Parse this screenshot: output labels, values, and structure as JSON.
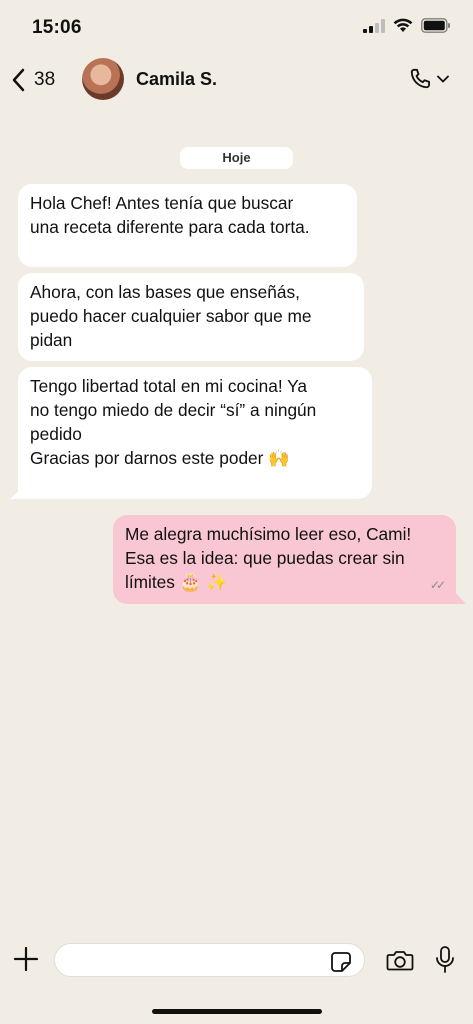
{
  "status_bar": {
    "time": "15:06",
    "icons": [
      "signal-icon",
      "wifi-icon",
      "battery-icon"
    ]
  },
  "header": {
    "back_count": "38",
    "contact_name": "Camila S.",
    "icons": [
      "back-chevron-icon",
      "avatar",
      "phone-icon",
      "chevron-down-icon"
    ]
  },
  "date_label": "Hoje",
  "messages": [
    {
      "from": "contact",
      "lines": [
        "Hola Chef! Antes tenía que buscar",
        "una receta diferente para cada torta."
      ]
    },
    {
      "from": "contact",
      "lines": [
        "Ahora, con las bases que enseñás,",
        "puedo hacer cualquier sabor que me",
        "pidan"
      ]
    },
    {
      "from": "contact",
      "lines": [
        "Tengo libertad total en mi cocina! Ya",
        "no tengo miedo de decir “sí” a ningún",
        "pedido",
        "Gracias por darnos este poder 🙌"
      ]
    },
    {
      "from": "me",
      "lines": [
        "Me alegra muchísimo leer eso, Cami!",
        "Esa es la idea: que puedas crear sin",
        "límites 🎂 ✨"
      ],
      "status": "✓✓"
    }
  ],
  "input_bar": {
    "icons": [
      "plus-icon",
      "sticker-icon",
      "camera-icon",
      "mic-icon"
    ]
  },
  "colors": {
    "background": "#f2ede4",
    "incoming_bubble": "#ffffff",
    "outgoing_bubble": "#f9c7d3"
  }
}
